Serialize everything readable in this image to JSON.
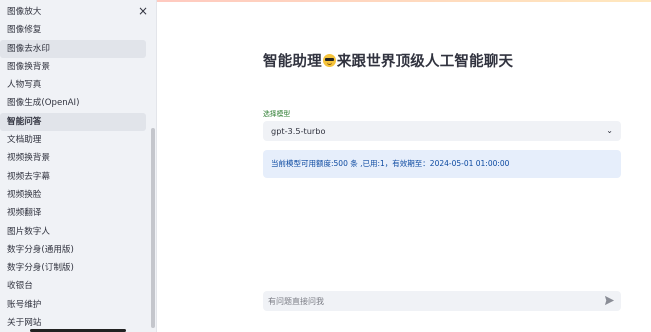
{
  "sidebar": {
    "close_label": "×",
    "items": [
      {
        "label": "图像放大",
        "state": ""
      },
      {
        "label": "图像修复",
        "state": ""
      },
      {
        "label": "图像去水印",
        "state": "hl"
      },
      {
        "label": "图像换背景",
        "state": ""
      },
      {
        "label": "人物写真",
        "state": ""
      },
      {
        "label": "图像生成(OpenAI)",
        "state": ""
      },
      {
        "label": "智能问答",
        "state": "active"
      },
      {
        "label": "文档助理",
        "state": ""
      },
      {
        "label": "视频换背景",
        "state": ""
      },
      {
        "label": "视频去字幕",
        "state": ""
      },
      {
        "label": "视频换脸",
        "state": ""
      },
      {
        "label": "视频翻译",
        "state": ""
      },
      {
        "label": "图片数字人",
        "state": ""
      },
      {
        "label": "数字分身(通用版)",
        "state": ""
      },
      {
        "label": "数字分身(订制版)",
        "state": ""
      },
      {
        "label": "收银台",
        "state": ""
      },
      {
        "label": "账号维护",
        "state": ""
      },
      {
        "label": "关于网站",
        "state": ""
      }
    ]
  },
  "main": {
    "title_before": "智能助理",
    "title_emoji": "smiling-face-with-sunglasses-icon",
    "title_after": "来跟世界顶级人工智能聊天",
    "model_label": "选择模型",
    "model_value": "gpt-3.5-turbo",
    "info_text": "当前模型可用额度:500 条 ,已用:1，有效期至：2024-05-01 01:00:00",
    "chat_placeholder": "有问题直接问我"
  },
  "colors": {
    "sidebar_bg": "#f0f2f6",
    "info_bg": "#e6eefb",
    "info_text": "#0d4aa1",
    "label_green": "#2e7d32"
  }
}
